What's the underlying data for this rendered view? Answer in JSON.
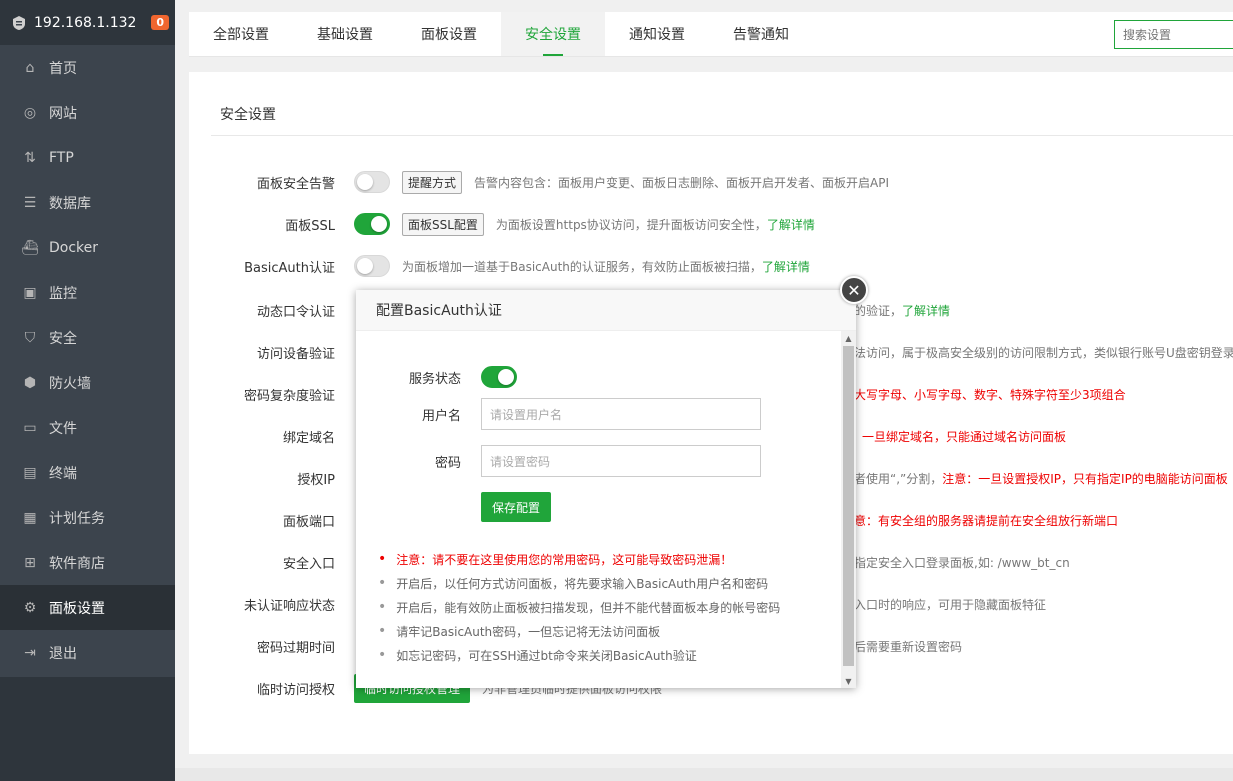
{
  "sidebar": {
    "host": "192.168.1.132",
    "badge": "0",
    "items": [
      {
        "label": "首页",
        "icon": "home-icon",
        "glyph": "⌂"
      },
      {
        "label": "网站",
        "icon": "globe-icon",
        "glyph": "◎"
      },
      {
        "label": "FTP",
        "icon": "ftp-icon",
        "glyph": "⇅"
      },
      {
        "label": "数据库",
        "icon": "database-icon",
        "glyph": "☰"
      },
      {
        "label": "Docker",
        "icon": "docker-icon",
        "glyph": "⛴"
      },
      {
        "label": "监控",
        "icon": "monitor-icon",
        "glyph": "▣"
      },
      {
        "label": "安全",
        "icon": "shield-icon",
        "glyph": "⛉"
      },
      {
        "label": "防火墙",
        "icon": "firewall-icon",
        "glyph": "⬢"
      },
      {
        "label": "文件",
        "icon": "folder-icon",
        "glyph": "▭"
      },
      {
        "label": "终端",
        "icon": "terminal-icon",
        "glyph": "▤"
      },
      {
        "label": "计划任务",
        "icon": "calendar-icon",
        "glyph": "▦"
      },
      {
        "label": "软件商店",
        "icon": "apps-icon",
        "glyph": "⊞"
      },
      {
        "label": "面板设置",
        "icon": "gear-icon",
        "glyph": "⚙"
      },
      {
        "label": "退出",
        "icon": "logout-icon",
        "glyph": "⇥"
      }
    ],
    "active_index": 12
  },
  "tabs": [
    "全部设置",
    "基础设置",
    "面板设置",
    "安全设置",
    "通知设置",
    "告警通知"
  ],
  "active_tab": 3,
  "search": {
    "placeholder": "搜索设置"
  },
  "panel": {
    "title": "安全设置",
    "rows": [
      {
        "label": "面板安全告警",
        "button": "提醒方式",
        "desc": "告警内容包含：面板用户变更、面板日志删除、面板开启开发者、面板开启API",
        "link": ""
      },
      {
        "label": "面板SSL",
        "button": "面板SSL配置",
        "desc": "为面板设置https协议访问，提升面板访问安全性，",
        "link": "了解详情"
      },
      {
        "label": "BasicAuth认证",
        "button": "",
        "desc": "为面板增加一道基于BasicAuth的认证服务，有效防止面板被扫描，",
        "link": "了解详情"
      },
      {
        "label": "动态口令认证",
        "desc": "的验证，",
        "link": "了解详情"
      },
      {
        "label": "访问设备验证",
        "desc": "法访问，属于极高安全级别的访问限制方式，类似银行账号U盘密钥登录"
      },
      {
        "label": "密码复杂度验证",
        "desc": "大写字母、小写字母、数字、特殊字符至少3项组合"
      },
      {
        "label": "绑定域名",
        "desc": "一旦绑定域名，只能通过域名访问面板"
      },
      {
        "label": "授权IP",
        "desc": "者使用“,”分割，",
        "desc_red": "注意：一旦设置授权IP，只有指定IP的电脑能访问面板"
      },
      {
        "label": "面板端口",
        "desc": "意：有安全组的服务器请提前在安全组放行新端口"
      },
      {
        "label": "安全入口",
        "desc": "指定安全入口登录面板,如: /www_bt_cn"
      },
      {
        "label": "未认证响应状态",
        "desc": "入口时的响应，可用于隐藏面板特征"
      },
      {
        "label": "密码过期时间",
        "desc": "后需要重新设置密码"
      },
      {
        "label": "临时访问授权",
        "button": "临时访问授权管理",
        "desc": "为非管理员临时提供面板访问权限"
      }
    ]
  },
  "modal": {
    "title": "配置BasicAuth认证",
    "status_label": "服务状态",
    "user_label": "用户名",
    "user_placeholder": "请设置用户名",
    "pass_label": "密码",
    "pass_placeholder": "请设置密码",
    "save_label": "保存配置",
    "tips": [
      "注意：请不要在这里使用您的常用密码，这可能导致密码泄漏！",
      "开启后，以任何方式访问面板，将先要求输入BasicAuth用户名和密码",
      "开启后，能有效防止面板被扫描发现，但并不能代替面板本身的帐号密码",
      "请牢记BasicAuth密码，一但忘记将无法访问面板",
      "如忘记密码，可在SSH通过bt命令来关闭BasicAuth验证"
    ]
  }
}
